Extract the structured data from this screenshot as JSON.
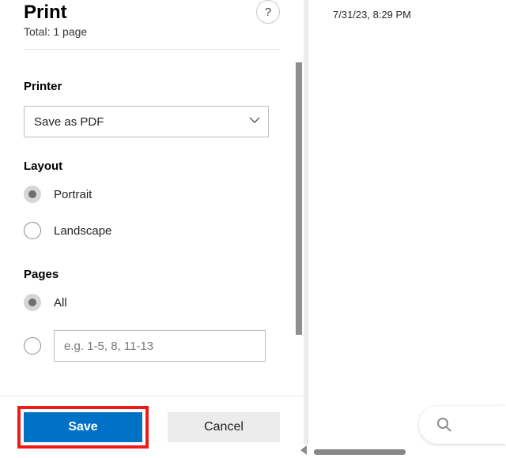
{
  "header": {
    "title": "Print",
    "subtitle": "Total: 1 page",
    "help_label": "?"
  },
  "printer": {
    "label": "Printer",
    "selected": "Save as PDF"
  },
  "layout": {
    "label": "Layout",
    "options": {
      "portrait": "Portrait",
      "landscape": "Landscape"
    }
  },
  "pages": {
    "label": "Pages",
    "all_label": "All",
    "range_placeholder": "e.g. 1-5, 8, 11-13"
  },
  "footer": {
    "save": "Save",
    "cancel": "Cancel"
  },
  "preview": {
    "timestamp": "7/31/23, 8:29 PM"
  }
}
